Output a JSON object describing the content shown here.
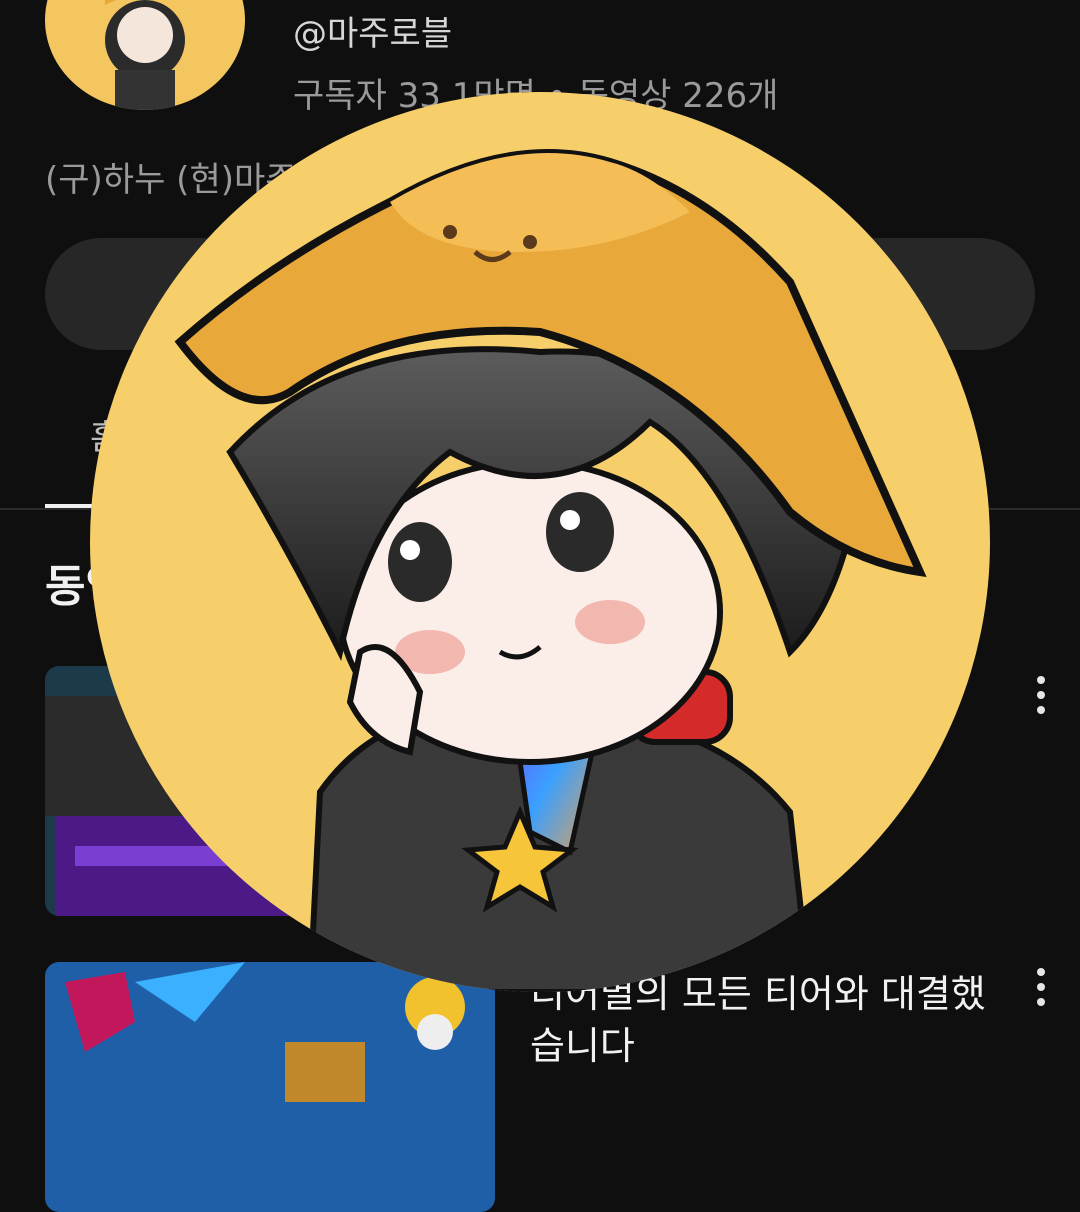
{
  "channel": {
    "handle": "@마주로블",
    "stats": "구독자 33.1만명 • 동영상 226개",
    "description": "(구)하누 (현)마주로블",
    "avatar_icon": "profile-avatar-icon"
  },
  "tabs": {
    "first_label": "홈"
  },
  "section": {
    "title": "동영상"
  },
  "videos": [
    {
      "title": "",
      "thumbnail_icon": "video-thumbnail-icon"
    },
    {
      "title": "티어별의 모든 티어와 대결했습니다",
      "thumbnail_icon": "video-thumbnail-icon"
    }
  ],
  "colors": {
    "background": "#0f0f0f",
    "avatar_yellow": "#f6cf6a",
    "hat": "#e8a83a",
    "headphones": "#d52a2a"
  }
}
